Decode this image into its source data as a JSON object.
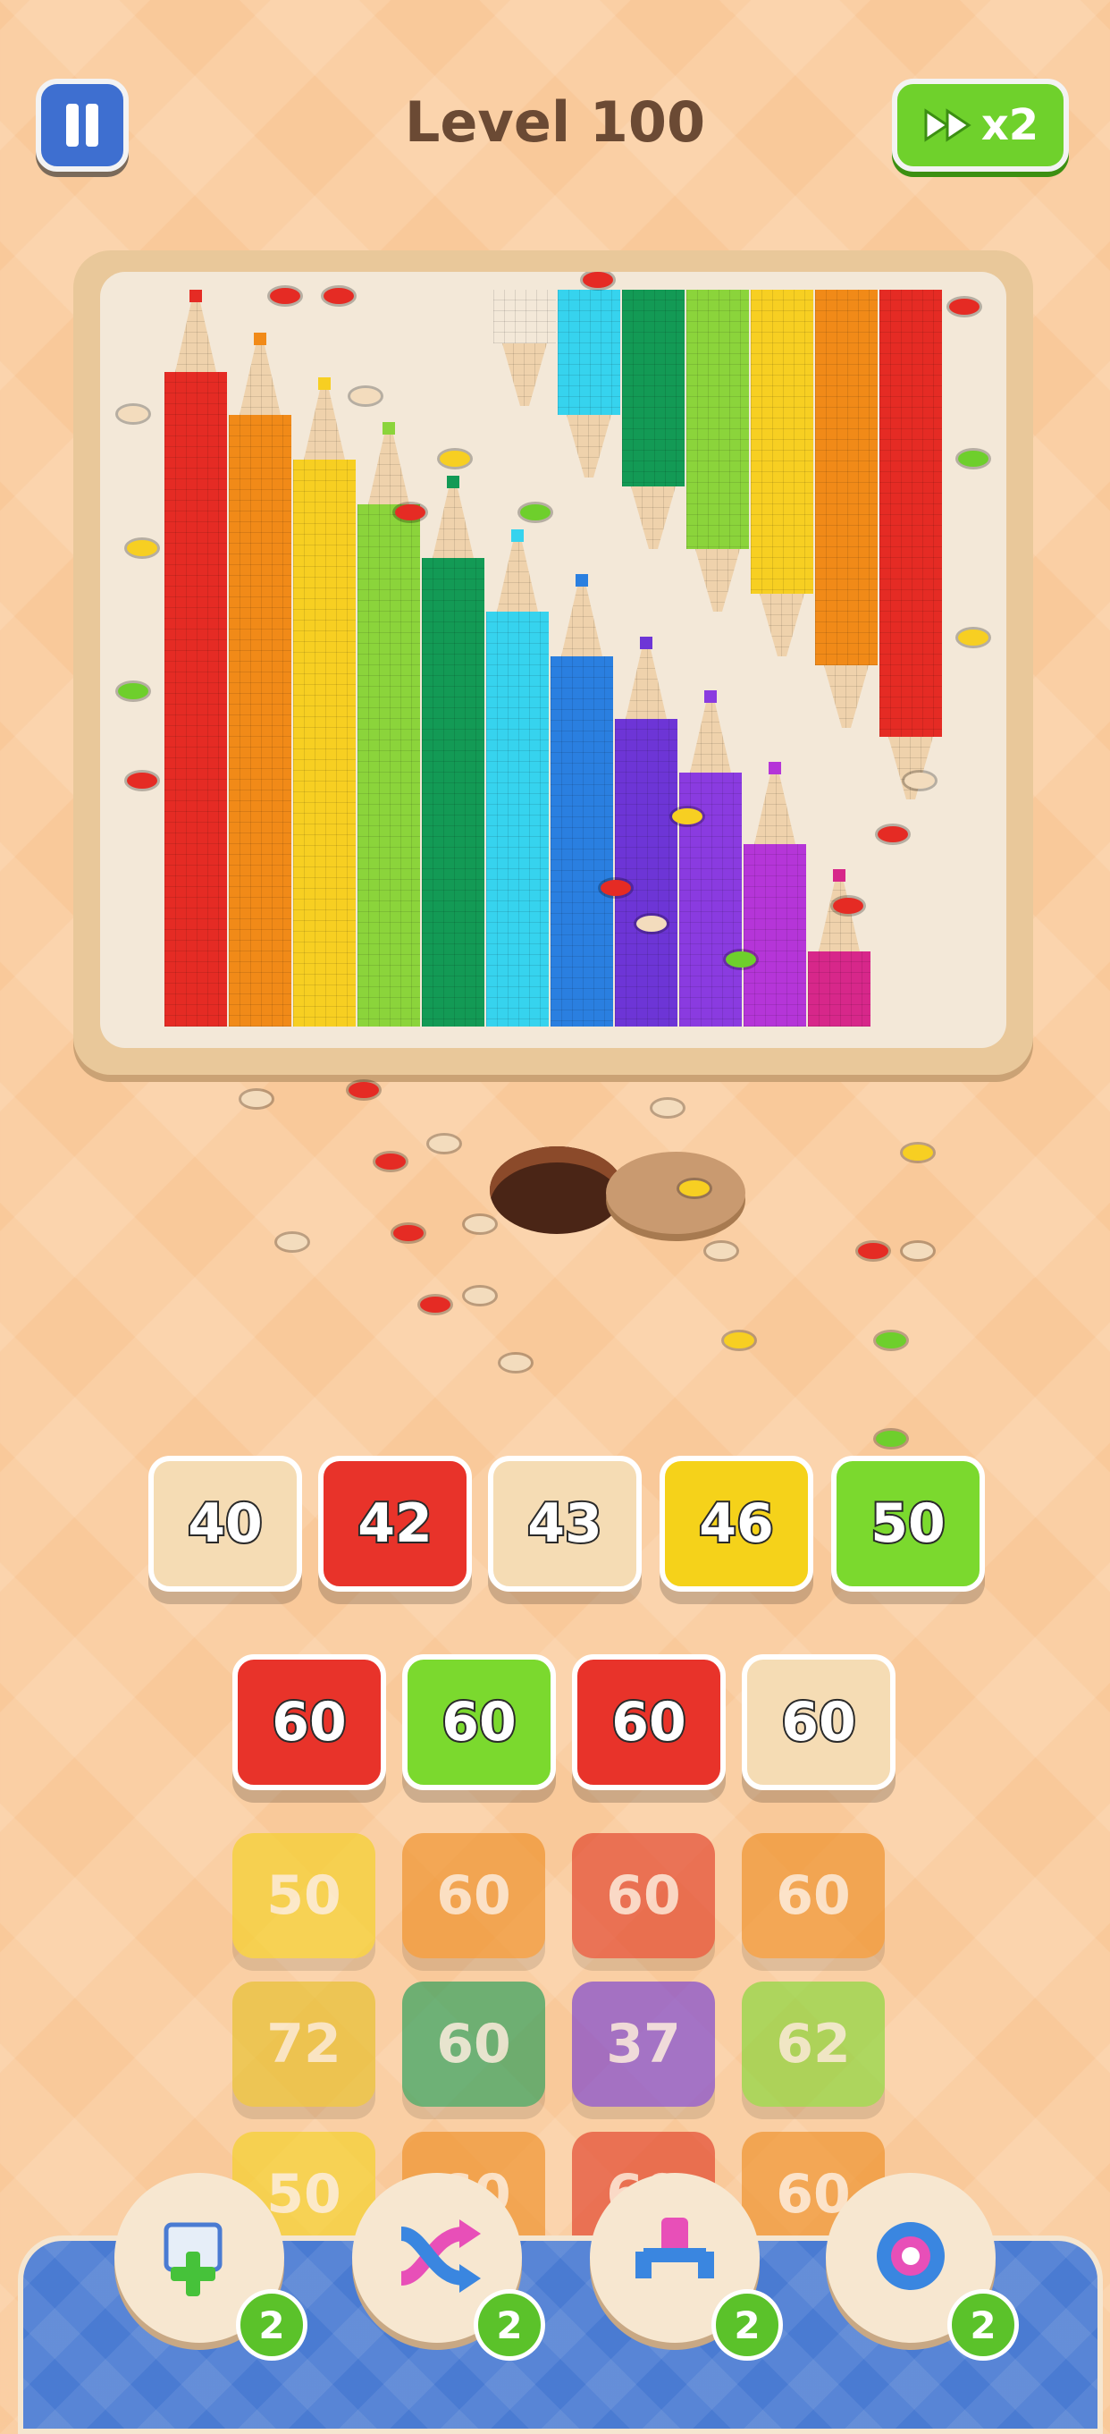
{
  "header": {
    "title": "Level 100",
    "speed_label": "x2",
    "speed_icon": "fast-forward-icon",
    "pause_icon": "pause-icon"
  },
  "board": {
    "pencil_colors": [
      "#e52b24",
      "#f18a18",
      "#f7cf22",
      "#8bd43b",
      "#139a55",
      "#36d3ee",
      "#2a7fe0",
      "#6d35d6",
      "#8a3be0",
      "#b535d8",
      "#d7278a"
    ],
    "top_pencil_colors": [
      "#f3e8d8",
      "#36d3ee",
      "#139a55",
      "#8bd43b",
      "#f7cf22",
      "#f18a18",
      "#e52b24"
    ]
  },
  "queue": {
    "rows": [
      [
        {
          "value": "40",
          "color": "#f5dcb4",
          "style": "hl"
        },
        {
          "value": "42",
          "color": "#e8332a",
          "style": "hl"
        },
        {
          "value": "43",
          "color": "#f5dcb4",
          "style": "hl"
        },
        {
          "value": "46",
          "color": "#f5d21a",
          "style": "hl"
        },
        {
          "value": "50",
          "color": "#7bd92e",
          "style": "hl"
        }
      ],
      [
        {
          "value": "60",
          "color": "#e8332a",
          "style": "hl"
        },
        {
          "value": "60",
          "color": "#7bd92e",
          "style": "hl"
        },
        {
          "value": "60",
          "color": "#e8332a",
          "style": "hl"
        },
        {
          "value": "60",
          "color": "#f5dcb4",
          "style": "hl"
        }
      ],
      [
        {
          "value": "50",
          "color": "#f5d21a",
          "style": "dim"
        },
        {
          "value": "60",
          "color": "#ee8a1c",
          "style": "dim"
        },
        {
          "value": "60",
          "color": "#e0341e",
          "style": "dim"
        },
        {
          "value": "60",
          "color": "#ee8a1c",
          "style": "dim"
        }
      ],
      [
        {
          "value": "72",
          "color": "#e6c020",
          "style": "dim"
        },
        {
          "value": "60",
          "color": "#129a52",
          "style": "dim"
        },
        {
          "value": "37",
          "color": "#6c33d6",
          "style": "dim"
        },
        {
          "value": "62",
          "color": "#7bd92e",
          "style": "dim"
        }
      ],
      [
        {
          "value": "50",
          "color": "#f5d21a",
          "style": "dim"
        },
        {
          "value": "60",
          "color": "#ee8a1c",
          "style": "dim"
        },
        {
          "value": "60",
          "color": "#e0341e",
          "style": "dim"
        },
        {
          "value": "60",
          "color": "#ee8a1c",
          "style": "dim"
        }
      ]
    ]
  },
  "powerups": [
    {
      "name": "add-slot-powerup",
      "icon": "add-box-icon",
      "count": "2"
    },
    {
      "name": "shuffle-powerup",
      "icon": "shuffle-arrow-icon",
      "count": "2"
    },
    {
      "name": "magnet-powerup",
      "icon": "magnet-icon",
      "count": "2"
    },
    {
      "name": "spool-powerup",
      "icon": "spool-icon",
      "count": "2"
    }
  ]
}
